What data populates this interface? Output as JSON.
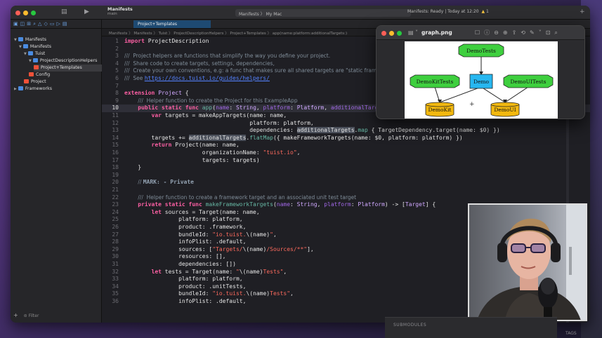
{
  "window": {
    "project": "Manifests",
    "project_sub": "main",
    "scheme_target": "Manifests",
    "scheme_device": "My Mac",
    "status": "Manifests: Ready | Today at 12:20",
    "warning_count": "1",
    "tab_label": "Project+Templates"
  },
  "breadcrumb": "Manifests 〉 Manifests 〉 Tuist 〉 ProjectDescriptionHelpers 〉 Project+Templates 〉 app(name:platform:additionalTargets:)",
  "navigator": {
    "items": [
      {
        "label": "Manifests",
        "depth": 0,
        "icon": "project",
        "disclosure": "open"
      },
      {
        "label": "Manifests",
        "depth": 1,
        "icon": "folder",
        "disclosure": "open"
      },
      {
        "label": "Tuist",
        "depth": 2,
        "icon": "folder",
        "disclosure": "open"
      },
      {
        "label": "ProjectDescriptionHelpers",
        "depth": 3,
        "icon": "folder",
        "disclosure": "open"
      },
      {
        "label": "Project+Templates",
        "depth": 4,
        "icon": "swift",
        "selected": true
      },
      {
        "label": "Config",
        "depth": 3,
        "icon": "swift"
      },
      {
        "label": "Project",
        "depth": 2,
        "icon": "swift"
      },
      {
        "label": "Frameworks",
        "depth": 0,
        "icon": "folder",
        "disclosure": "closed"
      }
    ],
    "filter_placeholder": "Filter"
  },
  "editor": {
    "highlighted_line": 10,
    "lines": [
      {
        "n": 1,
        "t": "<span class='kw'>import</span> ProjectDescription"
      },
      {
        "n": 2,
        "t": ""
      },
      {
        "n": 3,
        "t": "<span class='cm'>///  Project helpers are functions that simplify the way you define your project.</span>"
      },
      {
        "n": 4,
        "t": "<span class='cm'>///  Share code to create targets, settings, dependencies,</span>"
      },
      {
        "n": 5,
        "t": "<span class='cm'>///  Create your own conventions, e.g: a func that makes sure all shared targets are \"static frameworks\"</span>"
      },
      {
        "n": 6,
        "t": "<span class='cm'>///  See </span><span class='link'>https://docs.tuist.io/guides/helpers/</span>"
      },
      {
        "n": 7,
        "t": ""
      },
      {
        "n": 8,
        "t": "<span class='kw'>extension</span> <span class='ty'>Project</span> {"
      },
      {
        "n": 9,
        "t": "    <span class='cm'>///  Helper function to create the Project for this ExampleApp</span>"
      },
      {
        "n": 10,
        "t": "    <span class='kw'>public static func</span> <span class='fn'>app</span>(<span class='par'>name</span>: <span class='ty'>String</span>, <span class='par'>platform</span>: <span class='ty'>Platform</span>, <span class='par'>additionalTargets</span>: [<span class='ty'>String</span>]) -> <span class='ty'>Project</span> {"
      },
      {
        "n": 11,
        "t": "        <span class='kw'>var</span> targets = makeAppTargets(name: name,"
      },
      {
        "n": 12,
        "t": "                                     platform: platform,"
      },
      {
        "n": 13,
        "t": "                                     dependencies: <span class='sel'>additionalTargets</span>.<span class='fn'>map</span> { TargetDependency.target(name: $0) })"
      },
      {
        "n": 14,
        "t": "        targets += <span class='sel'>additionalTargets</span>.<span class='fn'>flatMap</span>({ makeFrameworkTargets(name: $0, platform: platform) })"
      },
      {
        "n": 15,
        "t": "        <span class='kw'>return</span> Project(name: name,"
      },
      {
        "n": 16,
        "t": "                       organizationName: <span class='str'>\"tuist.io\"</span>,"
      },
      {
        "n": 17,
        "t": "                       targets: targets)"
      },
      {
        "n": 18,
        "t": "    }"
      },
      {
        "n": 19,
        "t": ""
      },
      {
        "n": 20,
        "t": "    <span class='cm'>// </span><span class='cmk'>MARK: - Private</span>"
      },
      {
        "n": 21,
        "t": ""
      },
      {
        "n": 22,
        "t": "    <span class='cm'>///  Helper function to create a framework target and an associated unit test target</span>"
      },
      {
        "n": 23,
        "t": "    <span class='kw'>private static func</span> <span class='fn'>makeFrameworkTargets</span>(<span class='par'>name</span>: <span class='ty'>String</span>, <span class='par'>platform</span>: <span class='ty'>Platform</span>) -> [<span class='ty'>Target</span>] {"
      },
      {
        "n": 24,
        "t": "        <span class='kw'>let</span> sources = Target(name: name,"
      },
      {
        "n": 25,
        "t": "                platform: platform,"
      },
      {
        "n": 26,
        "t": "                product: .framework,"
      },
      {
        "n": 27,
        "t": "                bundleId: <span class='str'>\"io.tuist.</span>\\(name)<span class='str'>\"</span>,"
      },
      {
        "n": 28,
        "t": "                infoPlist: .default,"
      },
      {
        "n": 29,
        "t": "                sources: [<span class='str'>\"Targets/</span>\\(name)<span class='str'>/Sources/**\"</span>],"
      },
      {
        "n": 30,
        "t": "                resources: [],"
      },
      {
        "n": 31,
        "t": "                dependencies: [])"
      },
      {
        "n": 32,
        "t": "        <span class='kw'>let</span> tests = Target(name: <span class='str'>\"</span>\\(name)<span class='str'>Tests\"</span>,"
      },
      {
        "n": 33,
        "t": "                platform: platform,"
      },
      {
        "n": 34,
        "t": "                product: .unitTests,"
      },
      {
        "n": 35,
        "t": "                bundleId: <span class='str'>\"io.tuist.</span>\\(name)<span class='str'>Tests\"</span>,"
      },
      {
        "n": 36,
        "t": "                infoPlist: .default,"
      }
    ]
  },
  "preview": {
    "title": "graph.png",
    "graph": {
      "nodes": [
        {
          "id": "DemoTests",
          "shape": "octagon",
          "color": "#3ecf3e"
        },
        {
          "id": "DemoKitTests",
          "shape": "octagon",
          "color": "#3ecf3e"
        },
        {
          "id": "Demo",
          "shape": "box",
          "color": "#27b7f0"
        },
        {
          "id": "DemoUITests",
          "shape": "octagon",
          "color": "#3ecf3e"
        },
        {
          "id": "DemoKit",
          "shape": "cylinder",
          "color": "#f2b80f"
        },
        {
          "id": "DemoUI",
          "shape": "cylinder",
          "color": "#f2b80f"
        }
      ],
      "edges": [
        [
          "DemoTests",
          "Demo"
        ],
        [
          "DemoKitTests",
          "DemoKit"
        ],
        [
          "Demo",
          "DemoKit"
        ],
        [
          "Demo",
          "DemoUI"
        ],
        [
          "DemoUITests",
          "DemoUI"
        ]
      ]
    }
  },
  "background": {
    "submodules_label": "SUBMODULES",
    "tags_label": "TAGS"
  },
  "colors": {
    "accent": "#1e4a72",
    "keyword": "#fc5fa3",
    "string": "#fc6a5d",
    "type": "#d0a8ff"
  }
}
